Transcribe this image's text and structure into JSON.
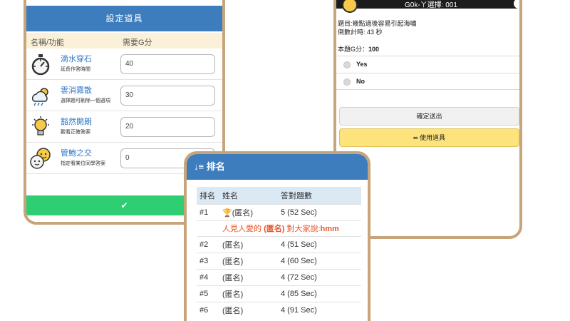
{
  "tools_panel": {
    "title": "設定道具",
    "col_name": "名稱/功能",
    "col_cost": "需要G分",
    "items": [
      {
        "icon": "stopwatch-icon",
        "name": "滴水穿石",
        "desc": "延長作答時間",
        "value": "40"
      },
      {
        "icon": "weather-icon",
        "name": "雲消霧散",
        "desc": "選擇題可刪除一個選項",
        "value": "30"
      },
      {
        "icon": "lightbulb-icon",
        "name": "豁然開朗",
        "desc": "觀看正確答案",
        "value": "20"
      },
      {
        "icon": "chat-emoji-icon",
        "name": "管鮑之交",
        "desc": "指定看某位同學答案",
        "value": "0"
      }
    ],
    "confirm_icon": "✔"
  },
  "quiz_panel": {
    "topbar_title": "G0k-ㄚ選擇: 001",
    "question": "題目:幾點過後容易引起海嘯",
    "countdown": "倒數計時: 43 秒",
    "score_label": "本題G分：",
    "score_value": "100",
    "options": [
      "Yes",
      "No"
    ],
    "submit_label": "確定送出",
    "use_tool_label": "使用道具",
    "use_tool_icon": "∞"
  },
  "ranking_panel": {
    "title": "排名",
    "title_icon": "↓≡",
    "headers": [
      "排名",
      "姓名",
      "答對題數"
    ],
    "rows": [
      {
        "rank": "#1",
        "name": "(匿名)",
        "score": "5 (52 Sec)",
        "trophy": "🏆"
      },
      {
        "rank": "#2",
        "name": "(匿名)",
        "score": "4 (51 Sec)"
      },
      {
        "rank": "#3",
        "name": "(匿名)",
        "score": "4 (60 Sec)"
      },
      {
        "rank": "#4",
        "name": "(匿名)",
        "score": "4 (72 Sec)"
      },
      {
        "rank": "#5",
        "name": "(匿名)",
        "score": "4 (85 Sec)"
      },
      {
        "rank": "#6",
        "name": "(匿名)",
        "score": "4 (91 Sec)"
      }
    ],
    "message_prefix": "人見人愛的",
    "message_name": "(匿名)",
    "message_middle": "對大家說:",
    "message_text": "hmm"
  }
}
